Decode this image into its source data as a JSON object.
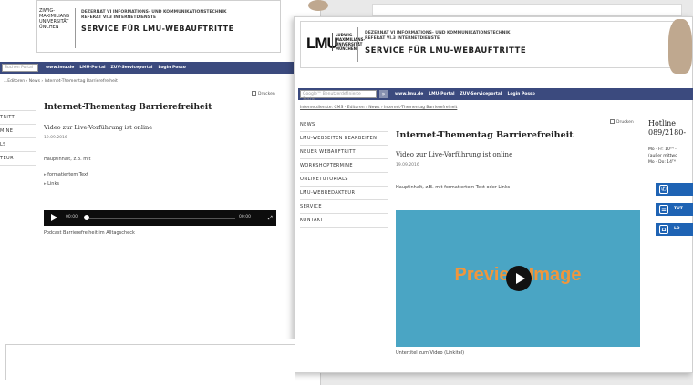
{
  "back": {
    "logo_lines": [
      "ZIWIG-",
      "MAXIMILIANS",
      "UNIVERSITÄT",
      "ÜNCHEN"
    ],
    "dept_line1": "DEZERNAT VI INFORMATIONS- UND KOMMUNIKATIONSTECHNIK",
    "dept_line2": "REFERAT VI.3 INTERNETDIENSTE",
    "service_title": "SERVICE FÜR LMU-WEBAUFTRITTE",
    "search_placeholder": "Suchen Portal",
    "nav_links": [
      "www.lmu.de",
      "LMU-Portal",
      "ZUV-Serviceportal",
      "Login Posso"
    ],
    "breadcrumb": "...Editoren › News › Internet-Thementag Barrierefreiheit",
    "drucken": "Drucken",
    "side_items": [
      "",
      "TRITT",
      "MINE",
      "LS",
      "TEUR"
    ],
    "title": "Internet-Thementag Barrierefreiheit",
    "subtitle": "Video zur Live-Vorführung ist online",
    "date": "19.09.2016",
    "hauptinhalt": "Hauptinhalt, z.B. mit",
    "bullets": [
      "formatiertem Text",
      "Links"
    ],
    "player_time": "00:00",
    "player_end": "00:00",
    "caption": "Podcast Barrierefreiheit im Alltagscheck"
  },
  "front": {
    "lmu_logo": "LMU",
    "lmu_sub": [
      "LUDWIG-",
      "MAXIMILIANS-",
      "UNIVERSITÄT",
      "MÜNCHEN"
    ],
    "dept_line1": "DEZERNAT VI INFORMATIONS- UND KOMMUNIKATIONSTECHNIK",
    "dept_line2": "REFERAT VI.3 INTERNETDIENSTE",
    "service_title": "SERVICE FÜR LMU-WEBAUFTRITTE",
    "search_placeholder": "Google™ Benutzerdefinierte Suche",
    "nav_links": [
      "www.lmu.de",
      "LMU-Portal",
      "ZUV-Serviceportal",
      "Login Posso"
    ],
    "breadcrumb": "Internetdienste: CMS - Editoren › News › Internet-Thementag Barrierefreiheit",
    "drucken": "Drucken",
    "side_items": [
      "NEWS",
      "LMU-WEBSEITEN BEARBEITEN",
      "NEUER WEBAUFTRITT",
      "WORKSHOPTERMINE",
      "ONLINETUTORIALS",
      "LMU-WEBREDAKTEUR",
      "SERVICE",
      "KONTAKT"
    ],
    "title": "Internet-Thementag Barrierefreiheit",
    "subtitle": "Video zur Live-Vorführung ist online",
    "date": "19.09.2016",
    "hauptinhalt": "Hauptinhalt, z.B. mit formatiertem Text oder Links",
    "video_preview": "Preview Image",
    "caption": "Untertitel zum Video (Linkitel)",
    "hotline_label": "Hotline",
    "hotline_number": "089/2180-",
    "hotline_info": [
      "Mo - Fr: 10ᵀᴴ -",
      "(außer mittwo",
      "Mo - Do: 14ᵀᴴ"
    ],
    "side_buttons": [
      "",
      "TUT",
      "LO"
    ]
  },
  "colors": {
    "nav": "#3b4a7e",
    "video_bg": "#4aa5c4",
    "preview_text": "#f0963c",
    "side_button": "#1e63b4"
  }
}
